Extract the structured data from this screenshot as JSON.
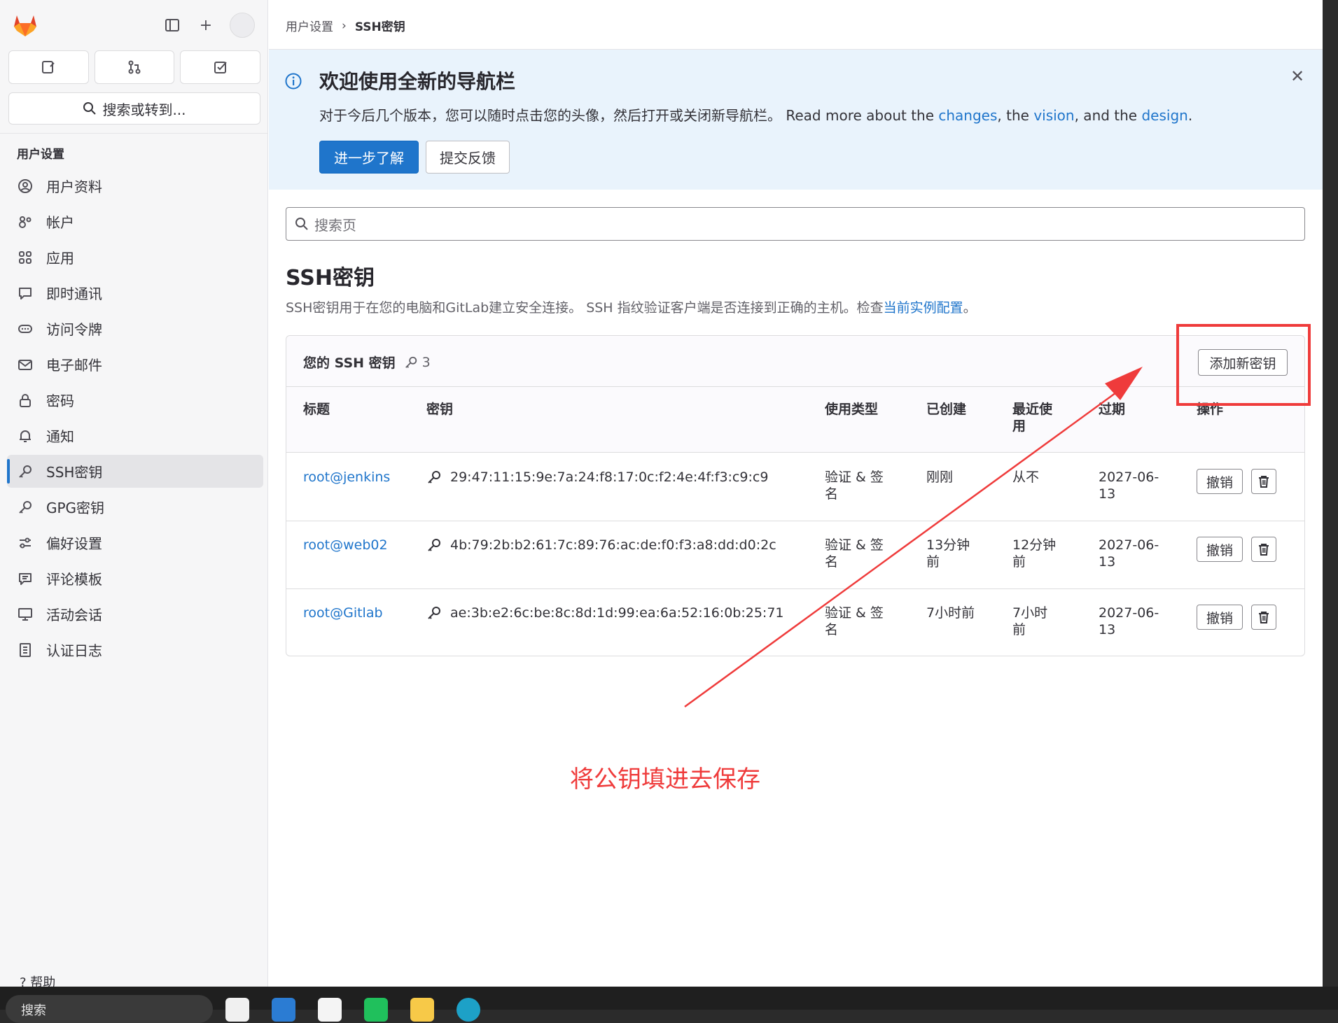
{
  "sidebar": {
    "search_label": "搜索或转到...",
    "section_title": "用户设置",
    "items": [
      {
        "label": "用户资料",
        "icon": "profile-icon"
      },
      {
        "label": "帐户",
        "icon": "account-icon"
      },
      {
        "label": "应用",
        "icon": "applications-icon"
      },
      {
        "label": "即时通讯",
        "icon": "chat-icon"
      },
      {
        "label": "访问令牌",
        "icon": "token-icon"
      },
      {
        "label": "电子邮件",
        "icon": "mail-icon"
      },
      {
        "label": "密码",
        "icon": "lock-icon"
      },
      {
        "label": "通知",
        "icon": "bell-icon"
      },
      {
        "label": "SSH密钥",
        "icon": "key-icon",
        "active": true
      },
      {
        "label": "GPG密钥",
        "icon": "key-icon"
      },
      {
        "label": "偏好设置",
        "icon": "preferences-icon"
      },
      {
        "label": "评论模板",
        "icon": "comment-template-icon"
      },
      {
        "label": "活动会话",
        "icon": "monitor-icon"
      },
      {
        "label": "认证日志",
        "icon": "log-icon"
      }
    ],
    "help_label": "帮助"
  },
  "breadcrumb": {
    "parent": "用户设置",
    "current": "SSH密钥"
  },
  "banner": {
    "title": "欢迎使用全新的导航栏",
    "text_cn": "对于今后几个版本，您可以随时点击您的头像，然后打开或关闭新导航栏。",
    "text_en_prefix": " Read more about the ",
    "link_changes": "changes",
    "sep1": ", the ",
    "link_vision": "vision",
    "sep2": ", and the ",
    "link_design": "design",
    "end": ".",
    "primary_button": "进一步了解",
    "secondary_button": "提交反馈"
  },
  "page_search_placeholder": "搜索页",
  "page": {
    "title": "SSH密钥",
    "description": "SSH密钥用于在您的电脑和GitLab建立安全连接。 SSH 指纹验证客户端是否连接到正确的主机。检查",
    "description_link": "当前实例配置",
    "description_end": "。"
  },
  "keys_card": {
    "title": "您的 SSH 密钥",
    "count": "3",
    "add_button": "添加新密钥",
    "columns": [
      "标题",
      "密钥",
      "使用类型",
      "已创建",
      "最近使\n用",
      "过期",
      "操作"
    ],
    "rows": [
      {
        "title": "root@jenkins",
        "fingerprint": "29:47:11:15:9e:7a:24:f8:17:0c:f2:4e:4f:f3:c9:c9",
        "usage": "验证 & 签\n名",
        "created": "刚刚",
        "last_used": "从不",
        "expires": "2027-06-\n13",
        "revoke": "撤销"
      },
      {
        "title": "root@web02",
        "fingerprint": "4b:79:2b:b2:61:7c:89:76:ac:de:f0:f3:a8:dd:d0:2c",
        "usage": "验证 & 签\n名",
        "created": "13分钟\n前",
        "last_used": "12分钟\n前",
        "expires": "2027-06-\n13",
        "revoke": "撤销"
      },
      {
        "title": "root@Gitlab",
        "fingerprint": "ae:3b:e2:6c:be:8c:8d:1d:99:ea:6a:52:16:0b:25:71",
        "usage": "验证 & 签\n名",
        "created": "7小时前",
        "last_used": "7小时\n前",
        "expires": "2027-06-\n13",
        "revoke": "撤销"
      }
    ]
  },
  "annotation": {
    "text": "将公钥填进去保存",
    "color": "#ef3b3b"
  },
  "taskbar": {
    "search_label": "搜索"
  },
  "colors": {
    "accent": "#1f75cb",
    "banner_bg": "#e9f3fc",
    "sidebar_bg": "#f6f6f7"
  }
}
